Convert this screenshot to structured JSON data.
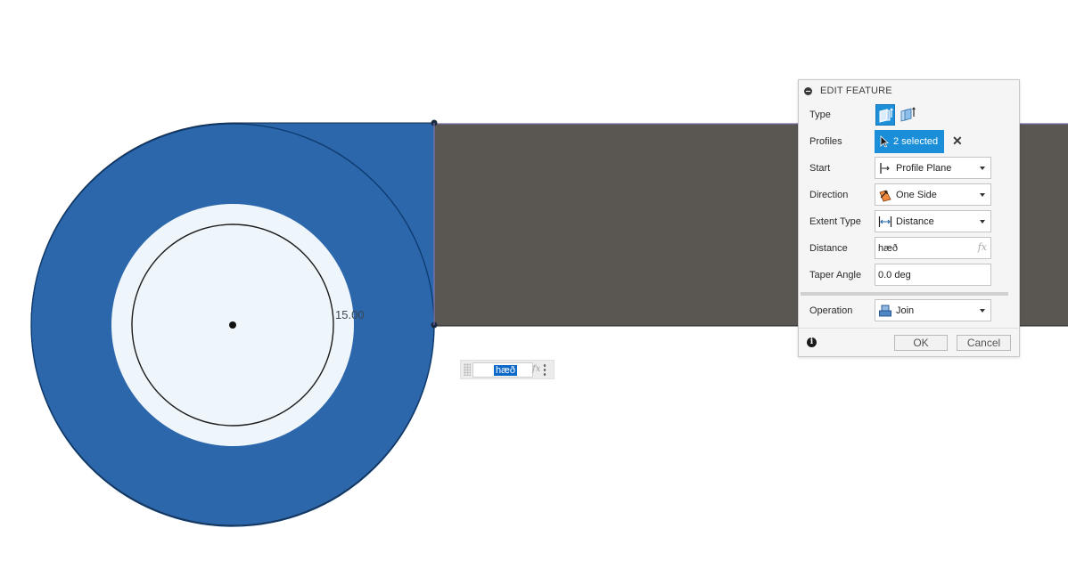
{
  "viewport": {
    "sketch_dimension_label": "15.00"
  },
  "inline_input": {
    "value": "hæð",
    "fx_label": "fx"
  },
  "dialog": {
    "title": "EDIT FEATURE",
    "rows": {
      "type": {
        "label": "Type"
      },
      "profiles": {
        "label": "Profiles",
        "value": "2 selected"
      },
      "start": {
        "label": "Start",
        "value": "Profile Plane"
      },
      "direction": {
        "label": "Direction",
        "value": "One Side"
      },
      "extent_type": {
        "label": "Extent Type",
        "value": "Distance"
      },
      "distance": {
        "label": "Distance",
        "value": "hæð",
        "fx_label": "fx"
      },
      "taper_angle": {
        "label": "Taper Angle",
        "value": "0.0 deg"
      },
      "operation": {
        "label": "Operation",
        "value": "Join"
      }
    },
    "footer": {
      "info_symbol": "i",
      "ok_label": "OK",
      "cancel_label": "Cancel"
    }
  },
  "colors": {
    "profile_fill": "#2c66ab",
    "inner_fill": "#eef5fb",
    "extrusion_face": "#5a5753",
    "accent": "#1a8ed9"
  },
  "icons": {
    "profiles_button": "cursor-arrow-icon",
    "start": "profile-plane-icon",
    "direction": "one-side-direction-icon",
    "extent_type": "distance-arrows-icon",
    "operation": "join-icon"
  }
}
